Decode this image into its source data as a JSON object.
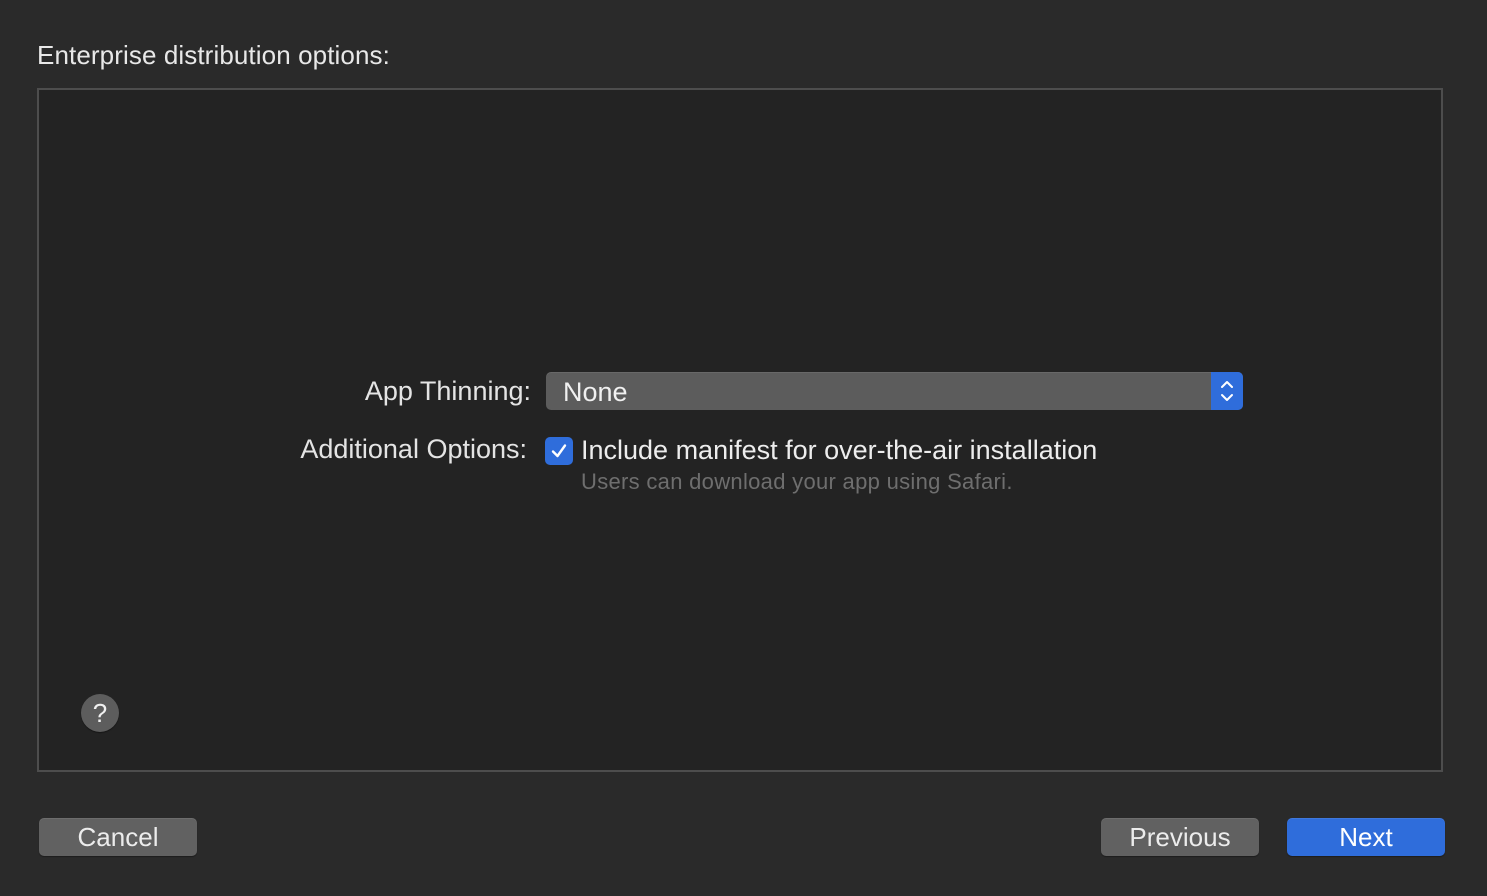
{
  "header": {
    "title": "Enterprise distribution options:"
  },
  "form": {
    "app_thinning": {
      "label": "App Thinning:",
      "selected_value": "None"
    },
    "additional_options": {
      "label": "Additional Options:",
      "checkbox_label": "Include manifest for over-the-air installation",
      "checkbox_checked": true,
      "help_text": "Users can download your app using Safari."
    }
  },
  "help": {
    "label": "?"
  },
  "footer": {
    "cancel_label": "Cancel",
    "previous_label": "Previous",
    "next_label": "Next"
  },
  "colors": {
    "accent": "#2f6ddb",
    "background": "#2a2a2a",
    "panel": "#232323"
  }
}
